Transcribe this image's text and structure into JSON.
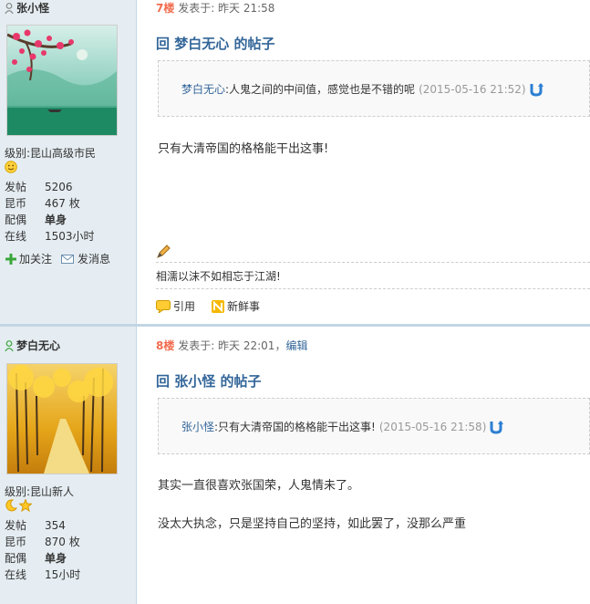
{
  "posts": [
    {
      "author": "张小怪",
      "rank_label": "级别:",
      "rank": "昆山高级市民",
      "stats": [
        {
          "k": "发帖",
          "v": "5206"
        },
        {
          "k": "昆币",
          "v": "467 枚"
        },
        {
          "k": "配偶",
          "v": "单身"
        },
        {
          "k": "在线",
          "v": "1503小时"
        }
      ],
      "follow": "加关注",
      "message": "发消息",
      "floor": "7楼",
      "posted": "发表于: 昨天 21:58",
      "title": "回 梦白无心 的帖子",
      "quote_name": "梦白无心",
      "quote_text": ":人鬼之间的中间值，感觉也是不错的呢",
      "quote_date": "(2015-05-16 21:52)",
      "content": [
        "只有大清帝国的格格能干出这事!"
      ],
      "signature": "相濡以沫不如相忘于江湖!",
      "cite": "引用",
      "news": "新鲜事"
    },
    {
      "author": "梦白无心",
      "rank_label": "级别:",
      "rank": "昆山新人",
      "stats": [
        {
          "k": "发帖",
          "v": "354"
        },
        {
          "k": "昆币",
          "v": "870 枚"
        },
        {
          "k": "配偶",
          "v": "单身"
        },
        {
          "k": "在线",
          "v": "15小时"
        }
      ],
      "floor": "8楼",
      "posted": "发表于: 昨天 22:01，",
      "edit": "编辑",
      "title": "回 张小怪 的帖子",
      "quote_name": "张小怪",
      "quote_text": ":只有大清帝国的格格能干出这事!",
      "quote_date": "(2015-05-16 21:58)",
      "content": [
        "其实一直很喜欢张国荣，人鬼情未了。",
        "没太大执念，只是坚持自己的坚持，如此罢了，没那么严重"
      ]
    }
  ],
  "colors": {
    "accent": "#336699",
    "floor": "#f26c4f",
    "sidebar": "#e5edf2"
  }
}
